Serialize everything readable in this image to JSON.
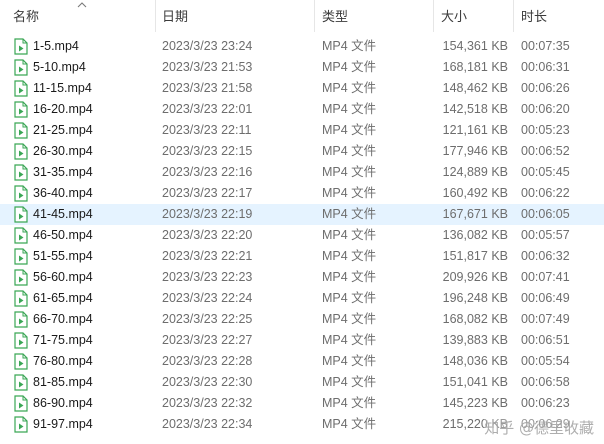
{
  "columns": {
    "name": "名称",
    "date": "日期",
    "type": "类型",
    "size": "大小",
    "duration": "时长"
  },
  "sort_icon": "chevron-up-icon",
  "file_icon": "video-file-icon",
  "accent_color": "#3aa655",
  "selected_row_color": "#e5f3ff",
  "files": [
    {
      "name": "1-5.mp4",
      "date": "2023/3/23 23:24",
      "type": "MP4 文件",
      "size": "154,361 KB",
      "duration": "00:07:35"
    },
    {
      "name": "5-10.mp4",
      "date": "2023/3/23 21:53",
      "type": "MP4 文件",
      "size": "168,181 KB",
      "duration": "00:06:31"
    },
    {
      "name": "11-15.mp4",
      "date": "2023/3/23 21:58",
      "type": "MP4 文件",
      "size": "148,462 KB",
      "duration": "00:06:26"
    },
    {
      "name": "16-20.mp4",
      "date": "2023/3/23 22:01",
      "type": "MP4 文件",
      "size": "142,518 KB",
      "duration": "00:06:20"
    },
    {
      "name": "21-25.mp4",
      "date": "2023/3/23 22:11",
      "type": "MP4 文件",
      "size": "121,161 KB",
      "duration": "00:05:23"
    },
    {
      "name": "26-30.mp4",
      "date": "2023/3/23 22:15",
      "type": "MP4 文件",
      "size": "177,946 KB",
      "duration": "00:06:52"
    },
    {
      "name": "31-35.mp4",
      "date": "2023/3/23 22:16",
      "type": "MP4 文件",
      "size": "124,889 KB",
      "duration": "00:05:45"
    },
    {
      "name": "36-40.mp4",
      "date": "2023/3/23 22:17",
      "type": "MP4 文件",
      "size": "160,492 KB",
      "duration": "00:06:22"
    },
    {
      "name": "41-45.mp4",
      "date": "2023/3/23 22:19",
      "type": "MP4 文件",
      "size": "167,671 KB",
      "duration": "00:06:05"
    },
    {
      "name": "46-50.mp4",
      "date": "2023/3/23 22:20",
      "type": "MP4 文件",
      "size": "136,082 KB",
      "duration": "00:05:57"
    },
    {
      "name": "51-55.mp4",
      "date": "2023/3/23 22:21",
      "type": "MP4 文件",
      "size": "151,817 KB",
      "duration": "00:06:32"
    },
    {
      "name": "56-60.mp4",
      "date": "2023/3/23 22:23",
      "type": "MP4 文件",
      "size": "209,926 KB",
      "duration": "00:07:41"
    },
    {
      "name": "61-65.mp4",
      "date": "2023/3/23 22:24",
      "type": "MP4 文件",
      "size": "196,248 KB",
      "duration": "00:06:49"
    },
    {
      "name": "66-70.mp4",
      "date": "2023/3/23 22:25",
      "type": "MP4 文件",
      "size": "168,082 KB",
      "duration": "00:07:49"
    },
    {
      "name": "71-75.mp4",
      "date": "2023/3/23 22:27",
      "type": "MP4 文件",
      "size": "139,883 KB",
      "duration": "00:06:51"
    },
    {
      "name": "76-80.mp4",
      "date": "2023/3/23 22:28",
      "type": "MP4 文件",
      "size": "148,036 KB",
      "duration": "00:05:54"
    },
    {
      "name": "81-85.mp4",
      "date": "2023/3/23 22:30",
      "type": "MP4 文件",
      "size": "151,041 KB",
      "duration": "00:06:58"
    },
    {
      "name": "86-90.mp4",
      "date": "2023/3/23 22:32",
      "type": "MP4 文件",
      "size": "145,223 KB",
      "duration": "00:06:23"
    },
    {
      "name": "91-97.mp4",
      "date": "2023/3/23 22:34",
      "type": "MP4 文件",
      "size": "215,220 KB",
      "duration": "00:06:29"
    }
  ],
  "highlighted_index": 8,
  "watermark": "知乎 @德里收藏"
}
